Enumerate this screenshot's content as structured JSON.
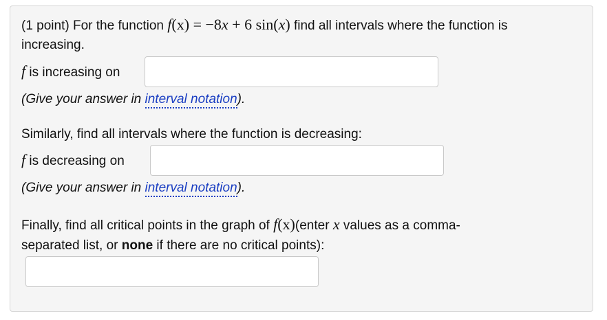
{
  "problem": {
    "points": "(1 point)",
    "intro_before_fn": " For the function ",
    "fn_name": "f",
    "fn_arg": "(x)",
    "fn_eq": " = −8",
    "fn_var": "x",
    "fn_rest": " + 6 sin(",
    "fn_var2": "x",
    "fn_close": ")",
    "intro_after_fn": " find all intervals where the function is",
    "intro_line2": "increasing."
  },
  "increasing": {
    "f_symbol": "f",
    "label": " is increasing on",
    "value": "",
    "hint_prefix": "(Give your answer in ",
    "hint_link": "interval notation",
    "hint_suffix": ")."
  },
  "decreasing": {
    "intro": "Similarly, find all intervals where the function is decreasing:",
    "f_symbol": "f",
    "label": " is decreasing on",
    "value": "",
    "hint_prefix": "(Give your answer in ",
    "hint_link": "interval notation",
    "hint_suffix": ")."
  },
  "critical": {
    "line1_prefix": "Finally, find all critical points in the graph of ",
    "fn_name": "f",
    "fn_arg": "(x)",
    "line1_mid": "(enter ",
    "var": "x",
    "line1_suffix": " values as a comma-",
    "line2_prefix": "separated list, or ",
    "line2_bold": "none",
    "line2_suffix": " if there are no critical points):",
    "value": ""
  },
  "colors": {
    "panel_background": "#f5f5f5",
    "link": "#1a3ec2"
  }
}
